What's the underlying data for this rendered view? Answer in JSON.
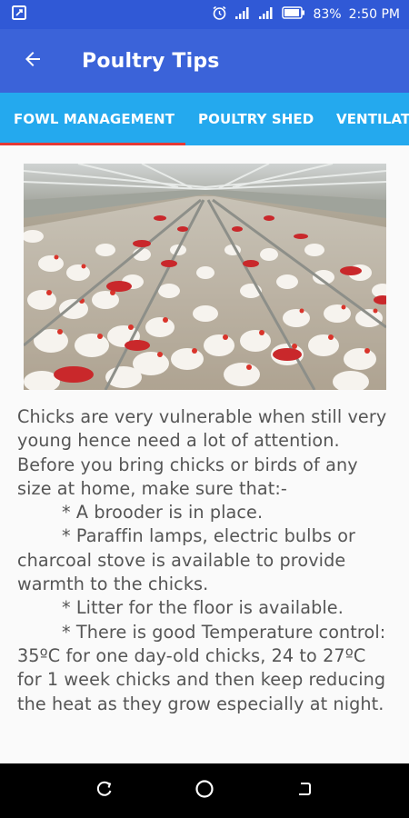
{
  "status_bar": {
    "battery_percent": "83%",
    "time": "2:50 PM",
    "icons": [
      "screenshot-icon",
      "alarm-icon",
      "signal-icon",
      "signal-icon",
      "battery-icon"
    ]
  },
  "app_bar": {
    "title": "Poultry Tips",
    "back_icon": "arrow-back-icon"
  },
  "tabs": [
    {
      "label": "FOWL MANAGEMENT",
      "selected": true
    },
    {
      "label": "POULTRY SHED",
      "selected": false
    },
    {
      "label": "VENTILAT",
      "selected": false
    }
  ],
  "article": {
    "image_icon": "poultry-farm-photo",
    "paragraphs": [
      "Chicks are very vulnerable when still very young hence need a lot of attention. Before you bring chicks or birds of any size at home, make sure that:-",
      "* A brooder is in place.",
      "* Paraffin lamps, electric bulbs or charcoal stove is available to provide warmth to the chicks.",
      "* Litter for the floor is available.",
      "* There is good Temperature control: 35ºC for one day-old chicks, 24 to 27ºC for 1 week chicks and then keep reducing the heat as they grow especially at night."
    ]
  },
  "nav_bar": {
    "icons": [
      "recent-apps-icon",
      "home-icon",
      "back-icon"
    ]
  },
  "colors": {
    "status_bar": "#3059d6",
    "app_bar": "#3b63d9",
    "tabs": "#24a9ee",
    "tab_indicator": "#e53935",
    "text": "#555555"
  }
}
